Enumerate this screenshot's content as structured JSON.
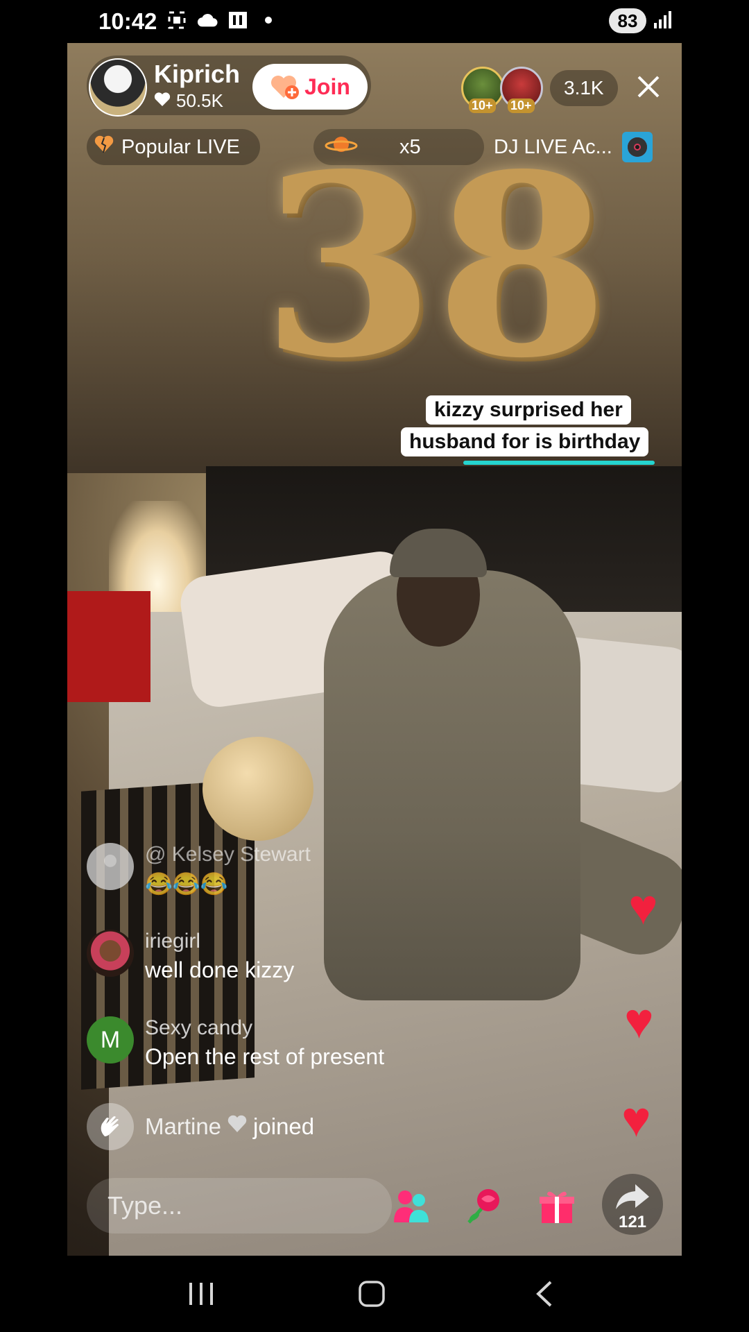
{
  "status_bar": {
    "time": "10:42",
    "battery": "83"
  },
  "live": {
    "host": {
      "name": "Kiprich",
      "likes": "50.5K"
    },
    "join_label": "Join",
    "viewers": {
      "badge_1": "10+",
      "badge_2": "10+",
      "count": "3.1K"
    },
    "chips": {
      "popular": "Popular LIVE",
      "multiplier": "x5",
      "dj": "DJ LIVE Ac..."
    },
    "caption": {
      "line1": "kizzy surprised her",
      "line2": "husband for is birthday"
    },
    "comments": [
      {
        "user": "@ Kelsey Stewart",
        "text": "😂😂😂"
      },
      {
        "user": "iriegirl",
        "text": "well done kizzy"
      },
      {
        "user": "Sexy candy",
        "text": "Open the rest of present",
        "avatar_letter": "M"
      }
    ],
    "joined": {
      "user": "Martine",
      "action": "joined"
    },
    "input_placeholder": "Type...",
    "share_count": "121",
    "video_numerals": "38"
  },
  "colors": {
    "accent": "#fe2c55",
    "heart": "#f2213e",
    "caption_underline": "#25d4d0"
  }
}
